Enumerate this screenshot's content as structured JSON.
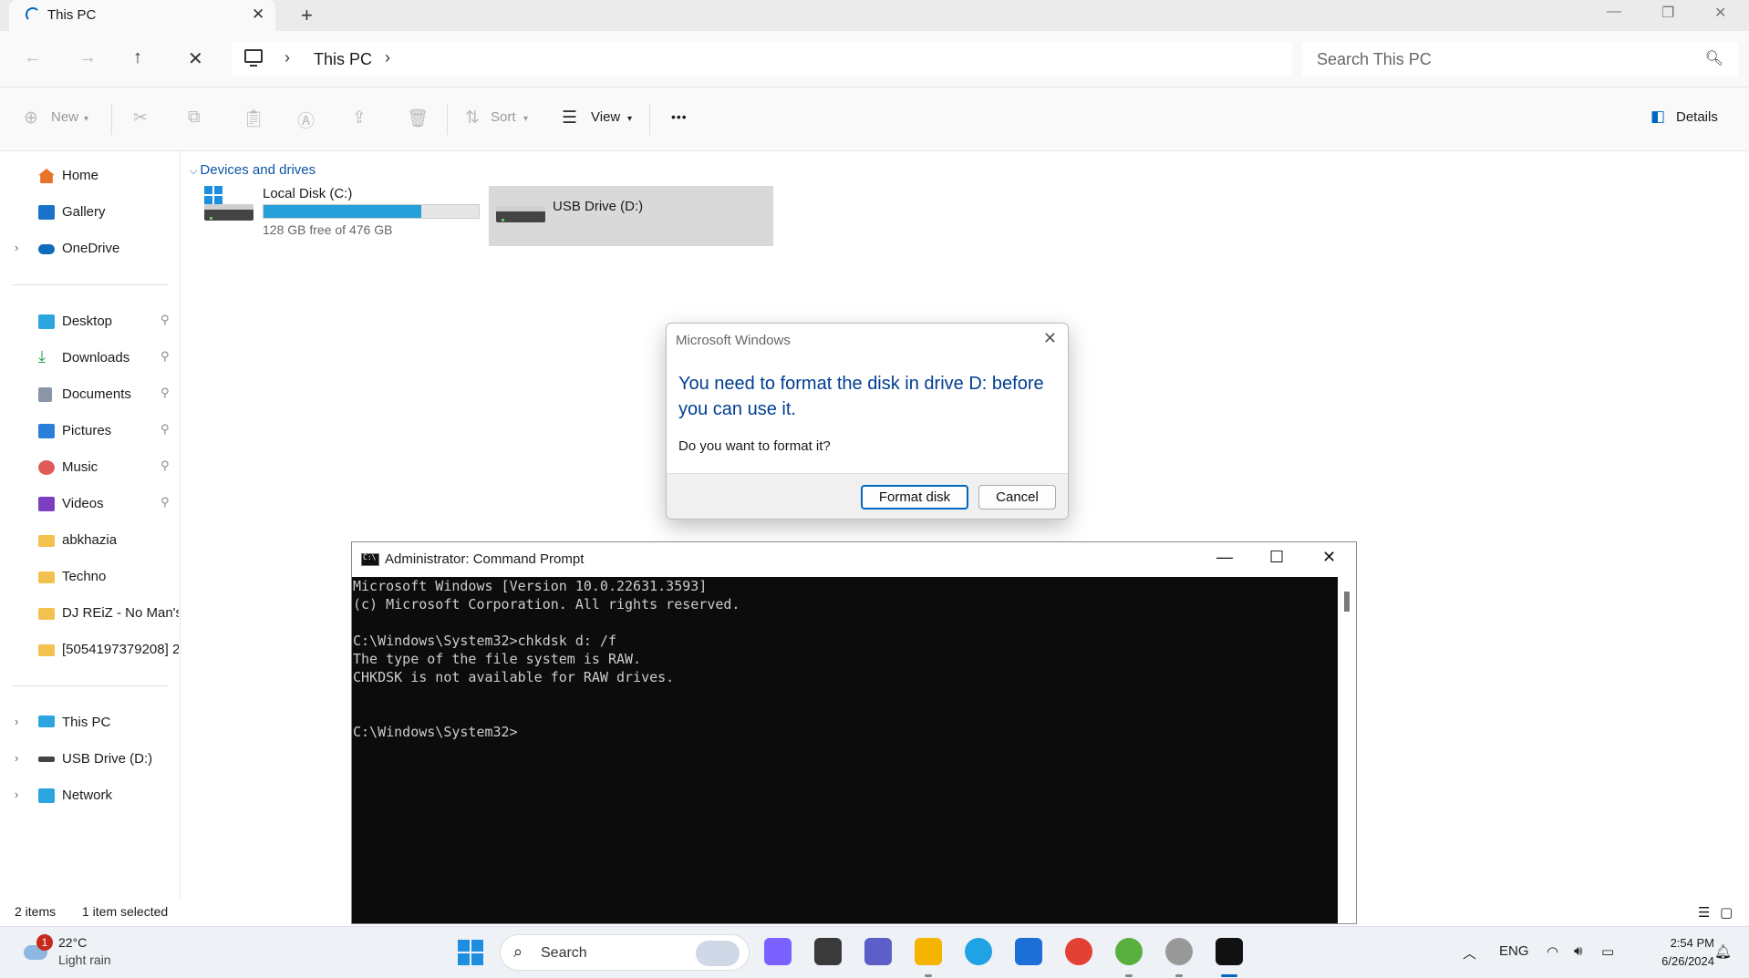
{
  "window": {
    "tab_title": "This PC",
    "tab_close": "✕",
    "new_tab": "+",
    "minimize": "—",
    "maximize": "❐",
    "close": "✕"
  },
  "navigation": {
    "back": "←",
    "forward": "→",
    "up": "↑",
    "stop": "✕",
    "breadcrumb": [
      "This PC"
    ],
    "chevron": "›",
    "search_placeholder": "Search This PC"
  },
  "toolbar": {
    "new_label": "New",
    "sort_label": "Sort",
    "view_label": "View",
    "more_label": "•••",
    "details_label": "Details"
  },
  "sidebar": {
    "top_items": [
      {
        "label": "Home",
        "icon": "home-icon",
        "color": "#e8742c"
      },
      {
        "label": "Gallery",
        "icon": "gallery-icon",
        "color": "#1a73c9"
      },
      {
        "label": "OneDrive",
        "icon": "onedrive-icon",
        "color": "#0f6cbd"
      }
    ],
    "pinned_items": [
      {
        "label": "Desktop",
        "icon": "desktop-folder-icon",
        "color": "#2da6e0"
      },
      {
        "label": "Downloads",
        "icon": "downloads-folder-icon",
        "color": "#1e9b4a"
      },
      {
        "label": "Documents",
        "icon": "documents-folder-icon",
        "color": "#8a96a8"
      },
      {
        "label": "Pictures",
        "icon": "pictures-folder-icon",
        "color": "#2b7fd8"
      },
      {
        "label": "Music",
        "icon": "music-folder-icon",
        "color": "#e05a5a"
      },
      {
        "label": "Videos",
        "icon": "videos-folder-icon",
        "color": "#7b3fbf"
      },
      {
        "label": "abkhazia",
        "icon": "folder-icon",
        "color": "#f2c14e"
      },
      {
        "label": "Techno",
        "icon": "folder-icon",
        "color": "#f2c14e"
      },
      {
        "label": "DJ REiZ - No Man's",
        "icon": "folder-icon",
        "color": "#f2c14e"
      },
      {
        "label": "[5054197379208] 2",
        "icon": "folder-icon",
        "color": "#f2c14e"
      }
    ],
    "bottom_items": [
      {
        "label": "This PC",
        "icon": "this-pc-icon",
        "color": "#2da6e0"
      },
      {
        "label": "USB Drive (D:)",
        "icon": "usb-drive-icon",
        "color": "#444444"
      },
      {
        "label": "Network",
        "icon": "network-icon",
        "color": "#2da6e0"
      }
    ],
    "pin_glyph": "📌"
  },
  "content": {
    "group_title": "Devices and drives",
    "drives": [
      {
        "name": "Local Disk (C:)",
        "free_text": "128 GB free of 476 GB",
        "used_fraction": 0.731,
        "selected": false
      },
      {
        "name": "USB Drive (D:)",
        "free_text": "",
        "used_fraction": null,
        "selected": true
      }
    ]
  },
  "statusbar": {
    "items_count": "2 items",
    "selection": "1 item selected"
  },
  "dialog": {
    "title": "Microsoft Windows",
    "heading": "You need to format the disk in drive D: before you can use it.",
    "question": "Do you want to format it?",
    "primary_button": "Format disk",
    "secondary_button": "Cancel"
  },
  "cmd": {
    "title": "Administrator: Command Prompt",
    "lines": [
      "Microsoft Windows [Version 10.0.22631.3593]",
      "(c) Microsoft Corporation. All rights reserved.",
      "",
      "C:\\Windows\\System32>chkdsk d: /f",
      "The type of the file system is RAW.",
      "CHKDSK is not available for RAW drives.",
      "",
      "",
      "C:\\Windows\\System32>"
    ]
  },
  "taskbar": {
    "weather_temp": "22°C",
    "weather_condition": "Light rain",
    "weather_badge": "1",
    "search_label": "Search",
    "apps": [
      {
        "name": "copilot-icon",
        "color": "#7b61ff"
      },
      {
        "name": "terminal-app-icon",
        "color": "#3a3a3a"
      },
      {
        "name": "teams-icon",
        "color": "#5b5fc7"
      },
      {
        "name": "file-explorer-icon",
        "color": "#f5b400"
      },
      {
        "name": "edge-icon",
        "color": "#1fa3e4"
      },
      {
        "name": "store-icon",
        "color": "#1b6fd6"
      },
      {
        "name": "chrome-icon",
        "color": "#e34133"
      },
      {
        "name": "utorrent-icon",
        "color": "#59b03f"
      },
      {
        "name": "app-ring-icon",
        "color": "#999999"
      },
      {
        "name": "cmd-icon",
        "color": "#111111"
      }
    ],
    "language": "ENG",
    "time": "2:54 PM",
    "date": "6/26/2024"
  }
}
